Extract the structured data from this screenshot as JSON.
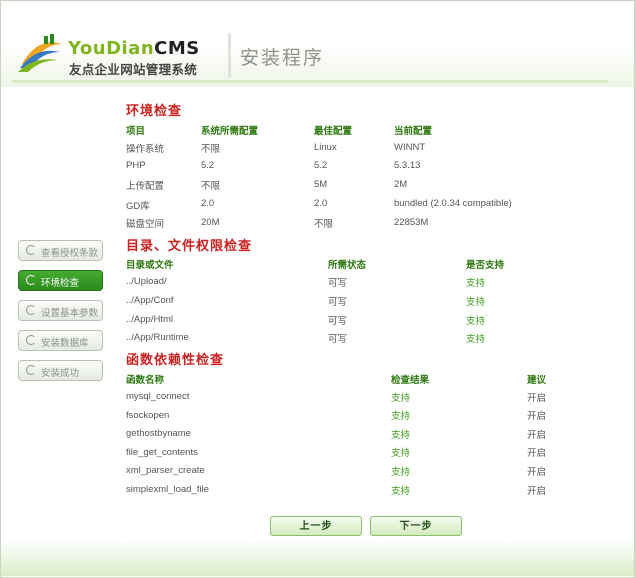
{
  "header": {
    "logo_en_green": "YouDian",
    "logo_en_dark": "CMS",
    "logo_cn": "友点企业网站管理系统",
    "page_title": "安装程序"
  },
  "sidebar": {
    "items": [
      {
        "label": "查看授权条款",
        "active": false
      },
      {
        "label": "环境检查",
        "active": true
      },
      {
        "label": "设置基本参数",
        "active": false
      },
      {
        "label": "安装数据库",
        "active": false
      },
      {
        "label": "安装成功",
        "active": false
      }
    ]
  },
  "env": {
    "title": "环境检查",
    "headers": [
      "项目",
      "系统所需配置",
      "最佳配置",
      "当前配置"
    ],
    "rows": [
      [
        "操作系统",
        "不限",
        "Linux",
        "WINNT"
      ],
      [
        "PHP",
        "5.2",
        "5.2",
        "5.3.13"
      ],
      [
        "上传配置",
        "不限",
        "5M",
        "2M"
      ],
      [
        "GD库",
        "2.0",
        "2.0",
        "bundled (2.0.34 compatible)"
      ],
      [
        "磁盘空间",
        "20M",
        "不限",
        "22853M"
      ]
    ]
  },
  "dirs": {
    "title": "目录、文件权限检查",
    "headers": [
      "目录或文件",
      "所需状态",
      "是否支持"
    ],
    "rows": [
      [
        "../Upload/",
        "可写",
        "支持"
      ],
      [
        "../App/Conf",
        "可写",
        "支持"
      ],
      [
        "../App/Html",
        "可写",
        "支持"
      ],
      [
        "../App/Runtime",
        "可写",
        "支持"
      ]
    ]
  },
  "funcs": {
    "title": "函数依赖性检查",
    "headers": [
      "函数名称",
      "检查结果",
      "建议"
    ],
    "rows": [
      [
        "mysql_connect",
        "支持",
        "开启"
      ],
      [
        "fsockopen",
        "支持",
        "开启"
      ],
      [
        "gethostbyname",
        "支持",
        "开启"
      ],
      [
        "file_get_contents",
        "支持",
        "开启"
      ],
      [
        "xml_parser_create",
        "支持",
        "开启"
      ],
      [
        "simplexml_load_file",
        "支持",
        "开启"
      ]
    ]
  },
  "buttons": {
    "prev": "上一步",
    "next": "下一步"
  },
  "colors": {
    "accent_green": "#2b8a1c",
    "section_red": "#cc2222",
    "ok_green": "#3e9a1c"
  }
}
